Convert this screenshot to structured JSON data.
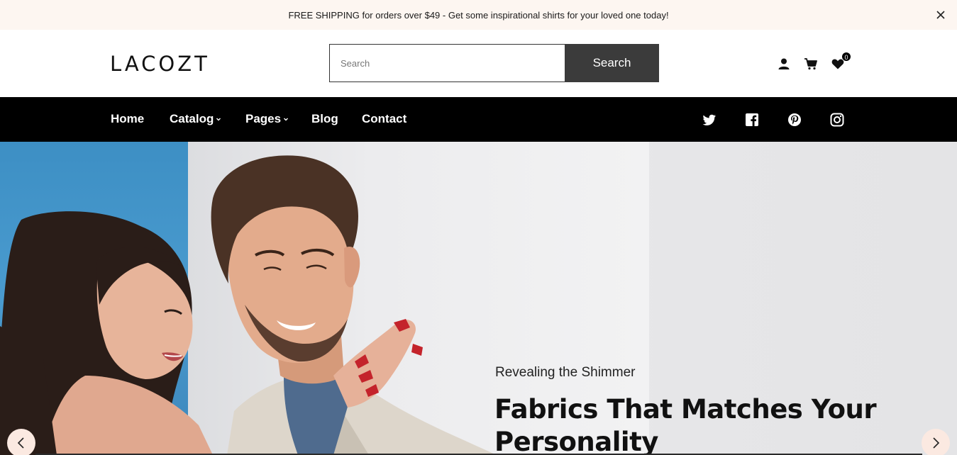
{
  "announcement": {
    "text": "FREE SHIPPING for orders over $49 - Get some inspirational shirts for your loved one today!",
    "close_icon": "close-icon"
  },
  "header": {
    "logo": "LACOZT",
    "search": {
      "placeholder": "Search",
      "value": "",
      "button_label": "Search"
    },
    "icons": [
      "account-icon",
      "cart-icon",
      "wishlist-icon"
    ],
    "wishlist_count": "0"
  },
  "nav": {
    "items": [
      {
        "label": "Home",
        "has_dropdown": false
      },
      {
        "label": "Catalog",
        "has_dropdown": true
      },
      {
        "label": "Pages",
        "has_dropdown": true
      },
      {
        "label": "Blog",
        "has_dropdown": false
      },
      {
        "label": "Contact",
        "has_dropdown": false
      }
    ],
    "social": [
      "twitter-icon",
      "facebook-icon",
      "pinterest-icon",
      "instagram-icon"
    ]
  },
  "hero": {
    "subtitle": "Revealing the Shimmer",
    "title": "Fabrics That Matches Your Personality",
    "prev_icon": "chevron-left-icon",
    "next_icon": "chevron-right-icon"
  },
  "colors": {
    "announcement_bg": "#fdf6f1",
    "nav_bg": "#000000",
    "search_button_bg": "#3b3b3b",
    "arrow_bg": "#fbe9e1",
    "hero_blue": "#4a9bcf"
  }
}
